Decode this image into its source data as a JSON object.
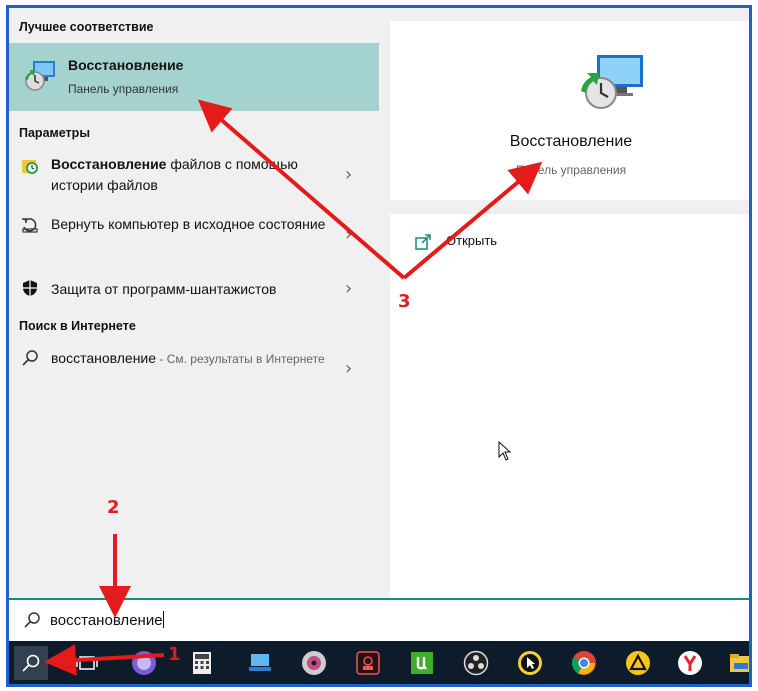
{
  "search_panel": {
    "best_match_header": "Лучшее соответствие",
    "best_match": {
      "title": "Восстановление",
      "subtitle": "Панель управления"
    },
    "settings_header": "Параметры",
    "settings_items": [
      {
        "bold": "Восстановление",
        "rest": " файлов с помощью истории файлов",
        "icon": "file-history-icon"
      },
      {
        "bold": "",
        "rest": "Вернуть компьютер в исходное состояние",
        "icon": "reset-pc-icon"
      },
      {
        "bold": "",
        "rest": "Защита от программ-шантажистов",
        "icon": "shield-icon"
      }
    ],
    "web_header": "Поиск в Интернете",
    "web_item": {
      "term": "восстановление",
      "suffix": " - См. результаты в Интернете"
    },
    "chevron": "›"
  },
  "preview": {
    "title": "Восстановление",
    "subtitle": "Панель управления",
    "open_action": "Открыть"
  },
  "search_box": {
    "value": "восстановление"
  },
  "taskbar": {
    "icons": [
      "search-icon",
      "task-view-icon",
      "messenger-icon",
      "calculator-icon",
      "pc-icon",
      "media-player-icon",
      "media-app-icon",
      "utorrent-icon",
      "obs-icon",
      "cursor-app-icon",
      "chrome-icon",
      "alert-app-icon",
      "yandex-browser-icon",
      "explorer-icon"
    ]
  },
  "annotations": {
    "step1": "1",
    "step2": "2",
    "step3": "3"
  },
  "colors": {
    "accent": "#1a8a78",
    "highlight": "#a4d3cf",
    "frame": "#1f5fcf",
    "arrow": "#e41b1b",
    "taskbar": "#0d1b2a"
  }
}
